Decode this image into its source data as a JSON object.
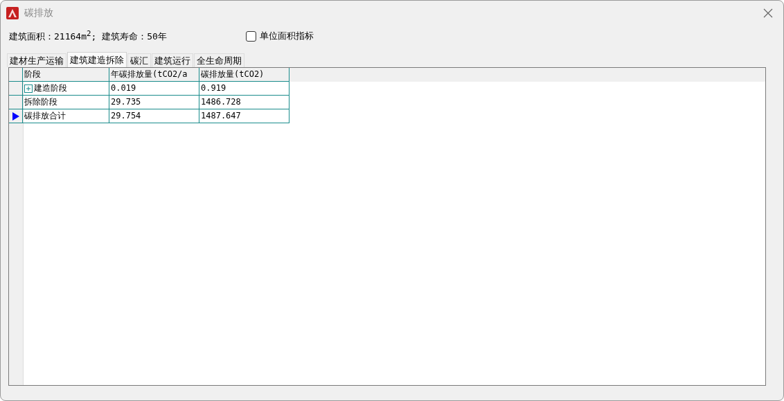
{
  "window": {
    "title": "碳排放"
  },
  "info": {
    "text": "建筑面积：21164m$^{2}$; 建筑寿命：50年"
  },
  "checkbox": {
    "label": "单位面积指标",
    "checked": false
  },
  "tabs": [
    {
      "label": "建材生产运输",
      "selected": false
    },
    {
      "label": "建筑建造拆除",
      "selected": true
    },
    {
      "label": "碳汇",
      "selected": false
    },
    {
      "label": "建筑运行",
      "selected": false
    },
    {
      "label": "全生命周期",
      "selected": false
    }
  ],
  "table": {
    "columns": [
      "阶段",
      "年碳排放量(tCO2/a",
      "碳排放量(tCO2)"
    ],
    "rows": [
      {
        "cells": [
          "建造阶段",
          "0.019",
          "0.919"
        ],
        "expandable": true,
        "selected": false
      },
      {
        "cells": [
          "拆除阶段",
          "29.735",
          "1486.728"
        ],
        "expandable": false,
        "selected": false
      },
      {
        "cells": [
          "碳排放合计",
          "29.754",
          "1487.647"
        ],
        "expandable": false,
        "selected": true
      }
    ]
  }
}
